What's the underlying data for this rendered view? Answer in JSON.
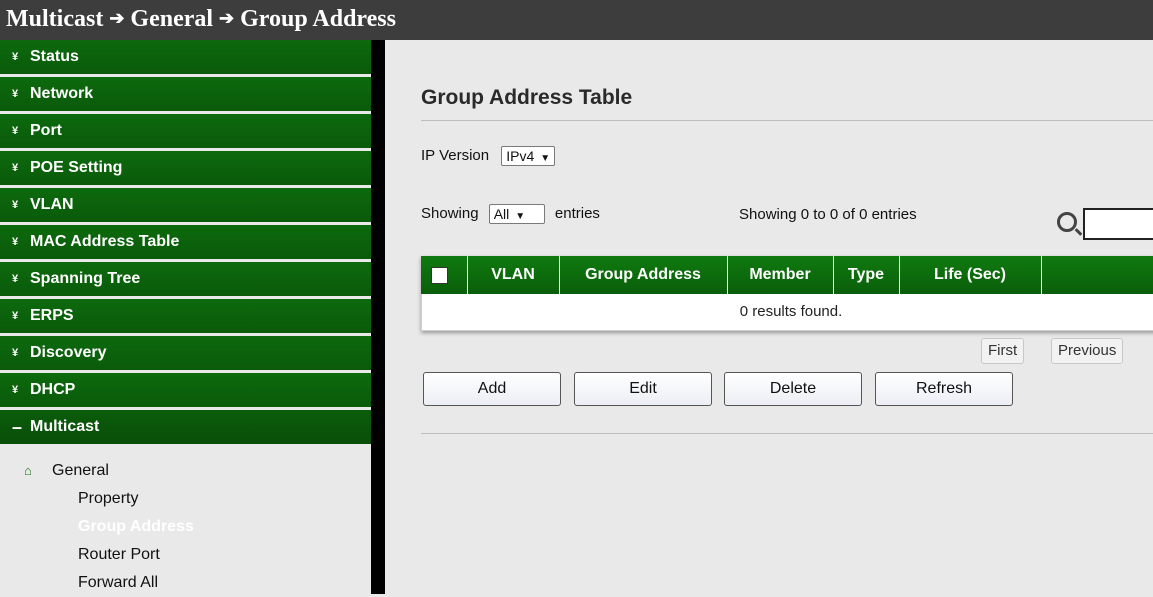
{
  "header": {
    "crumb1": "Multicast",
    "crumb2": "General",
    "crumb3": "Group Address",
    "arrow": "➔"
  },
  "sidebar": {
    "bullet": "¥",
    "items": [
      {
        "label": "Status"
      },
      {
        "label": "Network"
      },
      {
        "label": "Port"
      },
      {
        "label": "POE Setting"
      },
      {
        "label": "VLAN"
      },
      {
        "label": "MAC Address Table"
      },
      {
        "label": "Spanning Tree"
      },
      {
        "label": "ERPS"
      },
      {
        "label": "Discovery"
      },
      {
        "label": "DHCP"
      }
    ],
    "open_item": {
      "bullet": "–",
      "label": "Multicast"
    },
    "sub_head": {
      "icon": "⌂",
      "label": "General"
    },
    "sub_items": [
      {
        "label": "Property"
      },
      {
        "label": "Group Address"
      },
      {
        "label": "Router Port"
      },
      {
        "label": "Forward All"
      }
    ]
  },
  "main": {
    "title": "Group Address Table",
    "ip_version_label": "IP Version",
    "ip_version_value": "IPv4",
    "showing_label": "Showing",
    "showing_value": "All",
    "entries_label": "entries",
    "entries_info": "Showing 0 to 0 of 0 entries",
    "table": {
      "columns": [
        "VLAN",
        "Group Address",
        "Member",
        "Type",
        "Life (Sec)"
      ],
      "empty_text": "0 results found."
    },
    "pagination": {
      "first": "First",
      "previous": "Previous"
    },
    "buttons": {
      "add": "Add",
      "edit": "Edit",
      "delete": "Delete",
      "refresh": "Refresh"
    }
  },
  "colors": {
    "menu_green": "#0a5e0a",
    "header_dark": "#3d3d3d"
  }
}
